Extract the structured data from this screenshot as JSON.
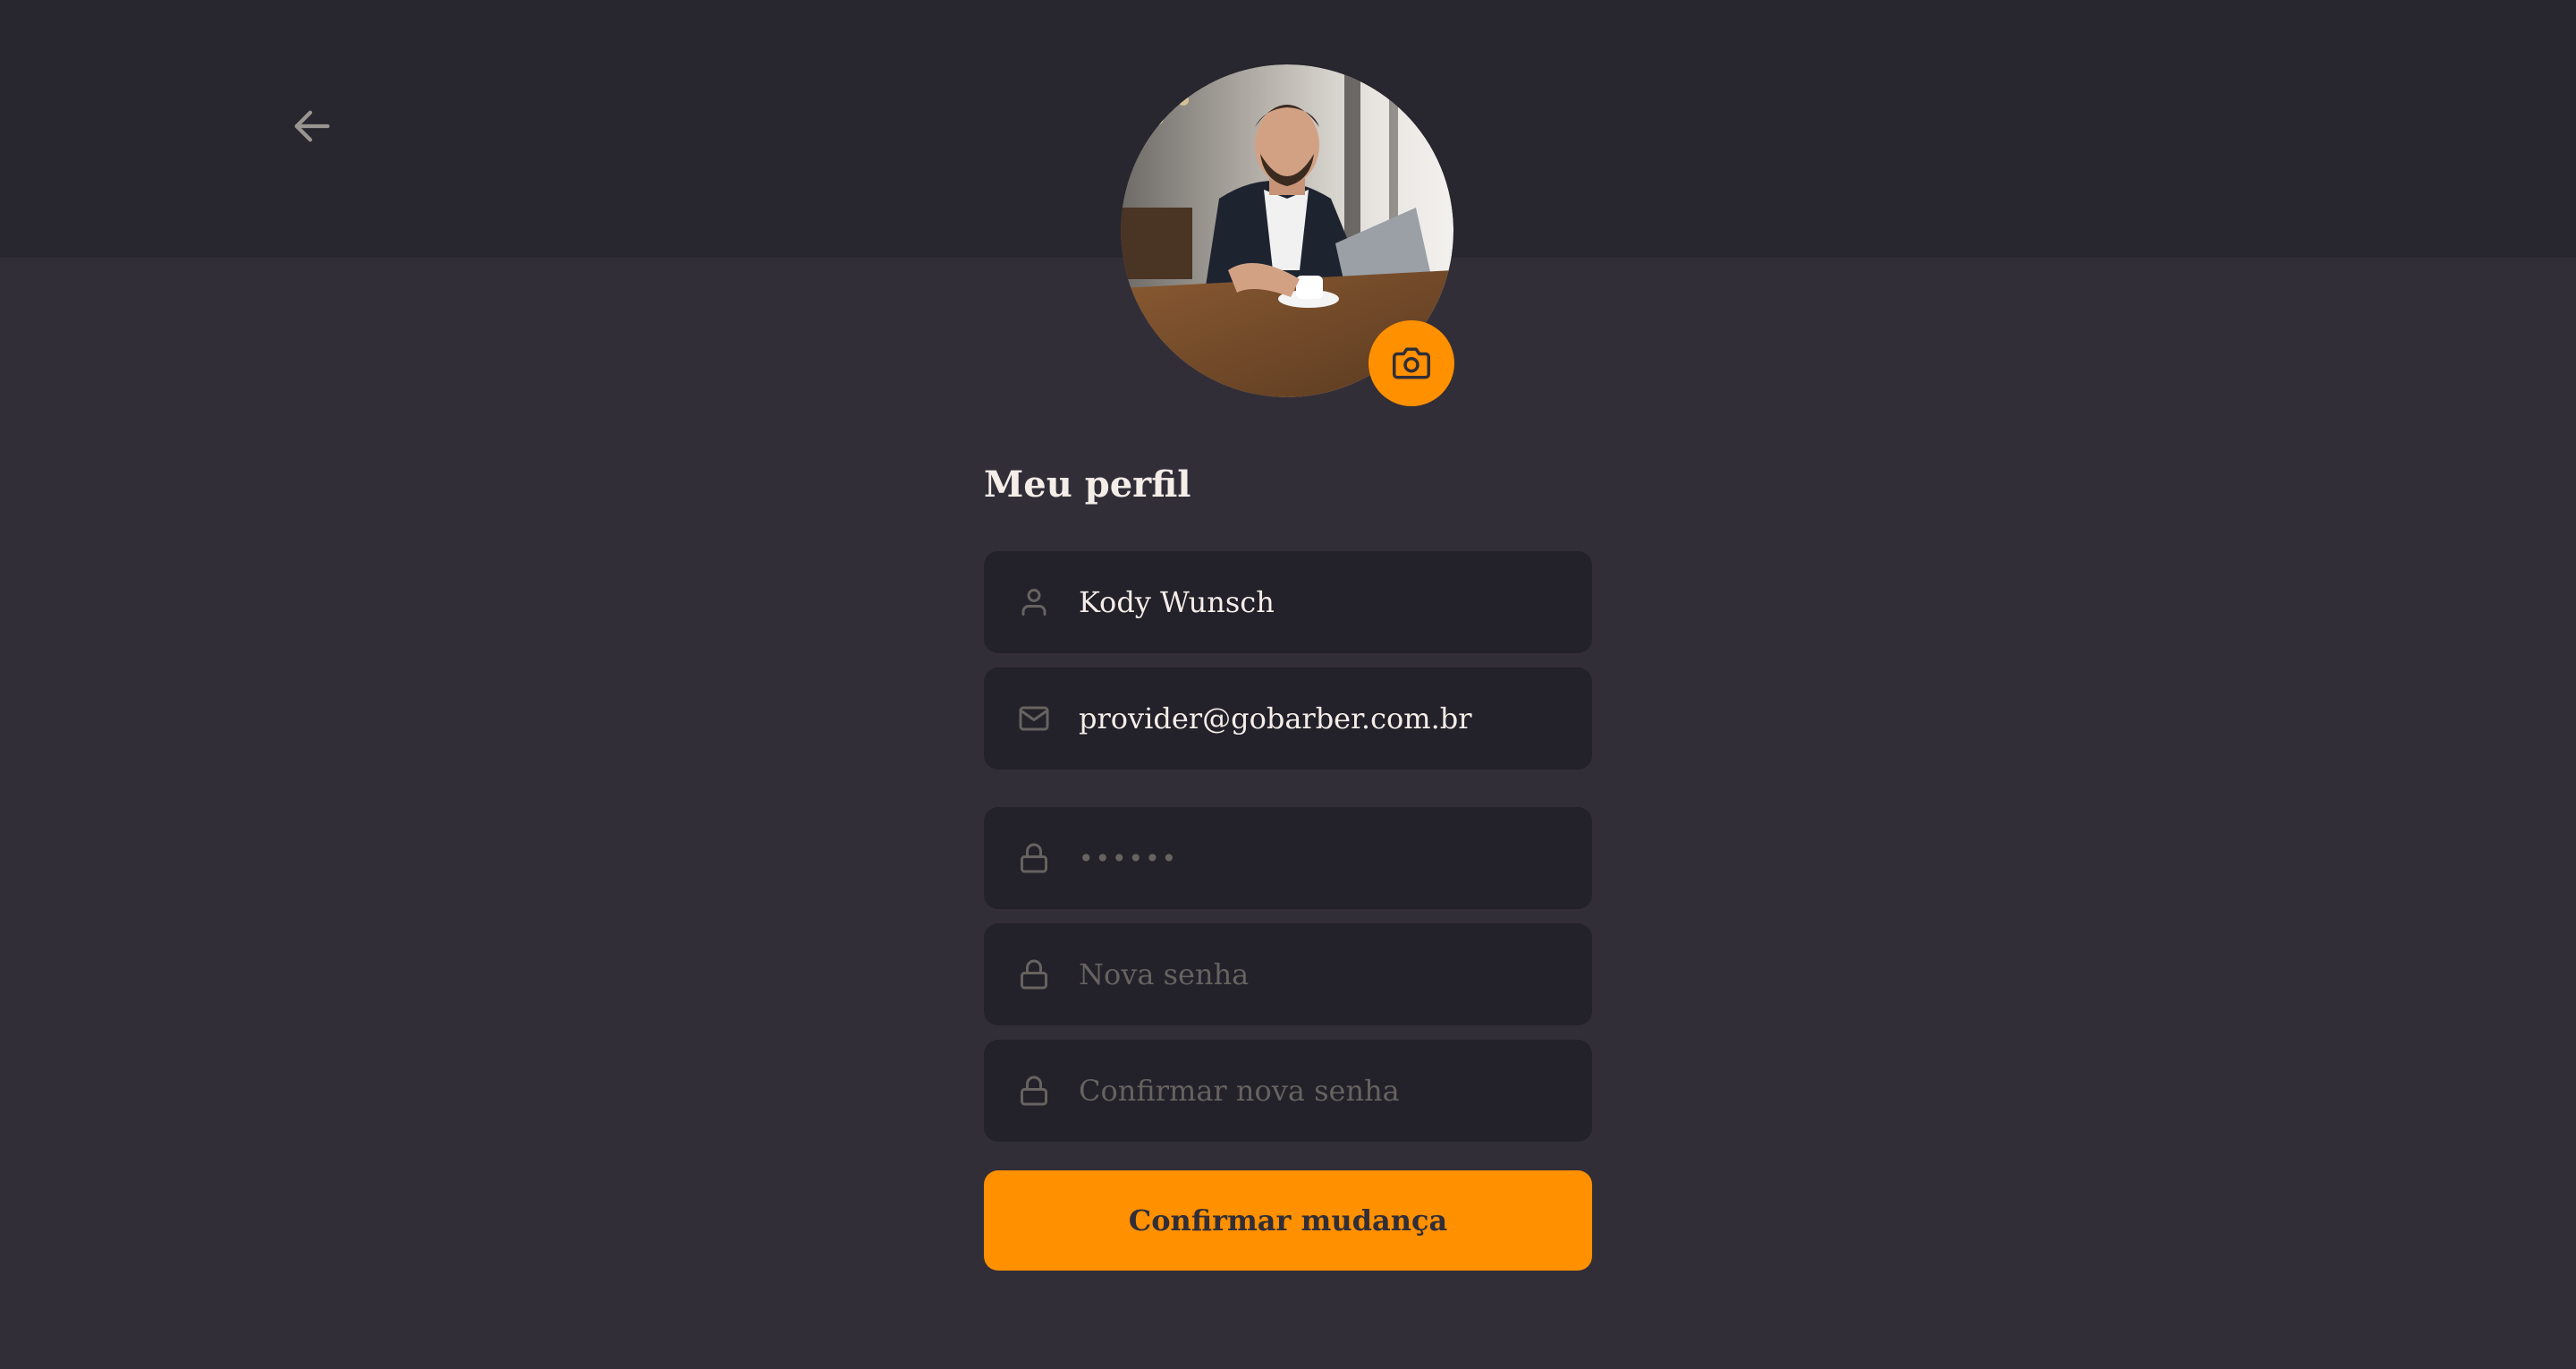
{
  "page": {
    "title": "Meu perfil"
  },
  "header": {
    "back_icon": "arrow-left-icon"
  },
  "avatar": {
    "description_icon": "camera-icon"
  },
  "form": {
    "name": {
      "value": "Kody Wunsch",
      "icon": "user-icon"
    },
    "email": {
      "value": "provider@gobarber.com.br",
      "icon": "mail-icon"
    },
    "old_password": {
      "value": "••••••",
      "icon": "lock-icon"
    },
    "new_password": {
      "placeholder": "Nova senha",
      "icon": "lock-icon"
    },
    "confirm_password": {
      "placeholder": "Confirmar nova senha",
      "icon": "lock-icon"
    },
    "submit_label": "Confirmar mudança"
  },
  "colors": {
    "background": "#312e38",
    "header": "#28262e",
    "input_background": "#232129",
    "accent": "#ff9000",
    "text": "#f4ede8",
    "placeholder": "#666360"
  }
}
